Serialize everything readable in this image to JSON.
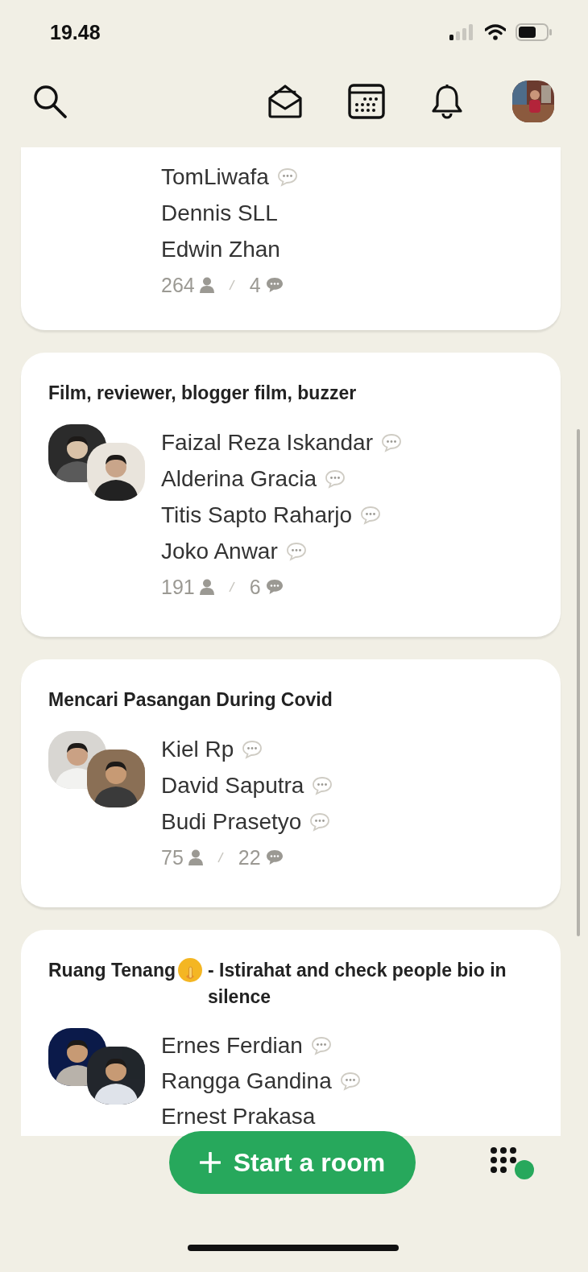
{
  "status_bar": {
    "time": "19.48"
  },
  "rooms": [
    {
      "participants": [
        {
          "name": "TomLiwafa",
          "speaking": true
        },
        {
          "name": "Dennis SLL",
          "speaking": false
        },
        {
          "name": "Edwin Zhan",
          "speaking": false
        }
      ],
      "listeners": "264",
      "speakers": "4"
    },
    {
      "title_parts": [
        {
          "kind": "text",
          "text": "Film, reviewer, blogger film, buzzer"
        }
      ],
      "avatars": [
        {
          "kind": "picture"
        },
        {
          "kind": "picture"
        }
      ],
      "participants": [
        {
          "name": "Faizal Reza Iskandar",
          "speaking": true
        },
        {
          "name": "Alderina Gracia",
          "speaking": true
        },
        {
          "name": "Titis Sapto Raharjo",
          "speaking": true
        },
        {
          "name": "Joko Anwar",
          "speaking": true
        }
      ],
      "listeners": "191",
      "speakers": "6"
    },
    {
      "title_parts": [
        {
          "kind": "text",
          "text": "Mencari Pasangan During Covid"
        }
      ],
      "avatars": [
        {
          "kind": "picture"
        },
        {
          "kind": "picture"
        }
      ],
      "participants": [
        {
          "name": "Kiel Rp",
          "speaking": true
        },
        {
          "name": "David Saputra",
          "speaking": true
        },
        {
          "name": "Budi Prasetyo",
          "speaking": true
        }
      ],
      "listeners": "75",
      "speakers": "22"
    },
    {
      "title_parts": [
        {
          "kind": "text",
          "text": "Ruang Tenang"
        },
        {
          "kind": "emoji"
        },
        {
          "kind": "text",
          "text": "- Istirahat and check people bio in silence"
        }
      ],
      "avatars": [
        {
          "kind": "picture"
        },
        {
          "kind": "picture"
        }
      ],
      "participants": [
        {
          "name": "Ernes Ferdian",
          "speaking": true
        },
        {
          "name": "Rangga Gandina",
          "speaking": true
        },
        {
          "name": "Ernest Prakasa",
          "speaking": false
        }
      ]
    }
  ],
  "start_button": {
    "label": "Start a room"
  }
}
